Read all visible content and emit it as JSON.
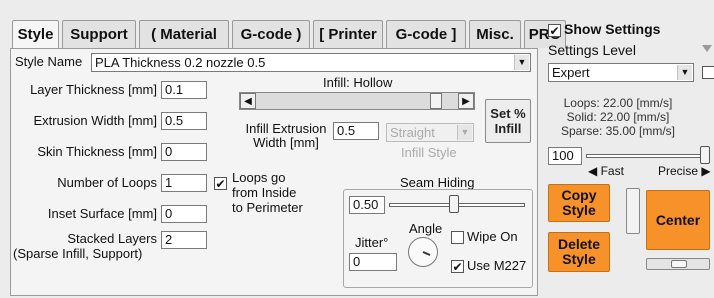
{
  "tabs": [
    {
      "label": "Style",
      "active": true
    },
    {
      "label": "Support",
      "active": false
    },
    {
      "label": "( Material",
      "active": false
    },
    {
      "label": "G-code )",
      "active": false
    },
    {
      "label": "[ Printer",
      "active": false
    },
    {
      "label": "G-code ]",
      "active": false
    },
    {
      "label": "Misc.",
      "active": false
    },
    {
      "label": "PRO",
      "active": false
    }
  ],
  "style_name": {
    "label": "Style Name",
    "value": "PLA Thickness 0.2 nozzle 0.5"
  },
  "fields": {
    "layer_thickness": {
      "label": "Layer Thickness [mm]",
      "value": "0.1"
    },
    "extrusion_width": {
      "label": "Extrusion Width [mm]",
      "value": "0.5"
    },
    "skin_thickness": {
      "label": "Skin Thickness [mm]",
      "value": "0"
    },
    "number_of_loops": {
      "label": "Number of Loops",
      "value": "1"
    },
    "inset_surface": {
      "label": "Inset  Surface [mm]",
      "value": "0"
    },
    "stacked_layers": {
      "label": "Stacked Layers",
      "sublabel": "(Sparse Infill, Support)",
      "value": "2"
    }
  },
  "loops_checkbox": {
    "checked": true,
    "label_lines": [
      "Loops go",
      "from Inside",
      "to Perimeter"
    ]
  },
  "infill": {
    "title": "Infill: Hollow",
    "extrusion_width_label_lines": [
      "Infill Extrusion",
      "Width [mm]"
    ],
    "extrusion_width_value": "0.5",
    "style_value": "Straight",
    "style_label": "Infill Style",
    "set_percent_button_lines": [
      "Set %",
      "Infill"
    ],
    "slider_fraction": 0.95
  },
  "seam": {
    "title": "Seam Hiding",
    "value": "0.50",
    "angle_label": "Angle",
    "jitter_label": "Jitter°",
    "jitter_value": "0",
    "wipe_on": {
      "label": "Wipe On",
      "checked": false
    },
    "use_m227": {
      "label": "Use M227",
      "checked": true
    }
  },
  "right": {
    "show_settings": {
      "label": "Show Settings",
      "checked": true
    },
    "settings_level_label": "Settings Level",
    "settings_level_value": "Expert",
    "speeds": [
      "Loops: 22.00 [mm/s]",
      "Solid: 22.00 [mm/s]",
      "Sparse: 35.00 [mm/s]"
    ],
    "speed_value": "100",
    "fast_label": "Fast",
    "precise_label": "Precise",
    "copy_style_lines": [
      "Copy",
      "Style"
    ],
    "delete_style_lines": [
      "Delete",
      "Style"
    ],
    "center_label": "Center"
  },
  "colors": {
    "accent_orange": "#f7922a"
  }
}
